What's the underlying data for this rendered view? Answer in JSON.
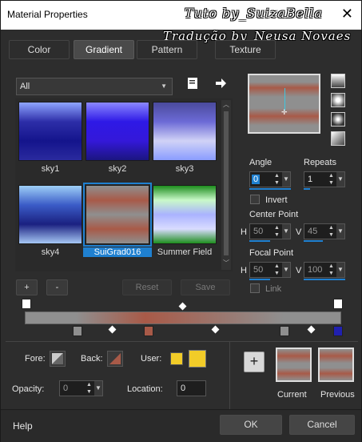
{
  "window": {
    "title": "Material Properties",
    "close_icon": "✕"
  },
  "watermark": {
    "line1": "Tuto by_SuizaBella",
    "line2": "Tradução by_Neusa Novaes"
  },
  "tabs": [
    "Color",
    "Gradient",
    "Pattern",
    "Texture"
  ],
  "active_tab": "Gradient",
  "library": {
    "filter_value": "All",
    "items": [
      {
        "name": "sky1",
        "colors": [
          "#8fa6ff",
          "#2d2ea8",
          "#14148c",
          "#2a2a9e"
        ]
      },
      {
        "name": "sky2",
        "colors": [
          "#8b88ff",
          "#2e19e6",
          "#3418d9",
          "#1b1580"
        ]
      },
      {
        "name": "sky3",
        "colors": [
          "#4a4a9c",
          "#6c6ad6",
          "#d0d2f6",
          "#8a9cff"
        ]
      },
      {
        "name": "sky4",
        "colors": [
          "#9ecff7",
          "#3b5cc7",
          "#1a2080",
          "#a6c8f4"
        ]
      },
      {
        "name": "SuiGrad016",
        "colors": [
          "#8f8f8f",
          "#a85a48",
          "#8f8f8f",
          "#a85a48",
          "#8f8f8f"
        ]
      },
      {
        "name": "Summer Field",
        "colors": [
          "#1d8d1d",
          "#c9f9c9",
          "#aab3ff",
          "#d9dcff",
          "#1d8d1d"
        ]
      }
    ]
  },
  "library_buttons": {
    "add": "+",
    "remove": "-",
    "reset": "Reset",
    "save": "Save"
  },
  "preview": {
    "angle_label": "Angle",
    "angle_value": "0",
    "repeats_label": "Repeats",
    "repeats_value": "1",
    "invert_label": "Invert",
    "center_point_label": "Center Point",
    "center_h_label": "H",
    "center_h": "50",
    "center_v_label": "V",
    "center_v": "45",
    "focal_point_label": "Focal Point",
    "focal_h_label": "H",
    "focal_h": "50",
    "focal_v_label": "V",
    "focal_v": "100",
    "link_label": "Link"
  },
  "bottom": {
    "fore_label": "Fore:",
    "back_label": "Back:",
    "user_label": "User:",
    "user_color": "#f2cc28",
    "opacity_label": "Opacity:",
    "opacity_value": "0",
    "location_label": "Location:",
    "location_value": "0",
    "current_label": "Current",
    "previous_label": "Previous",
    "add_icon": "+"
  },
  "footer": {
    "help": "Help",
    "ok": "OK",
    "cancel": "Cancel"
  },
  "colors": {
    "accent": "#1f80d0",
    "gray": "#8f8f8f",
    "rust": "#a85a48"
  }
}
